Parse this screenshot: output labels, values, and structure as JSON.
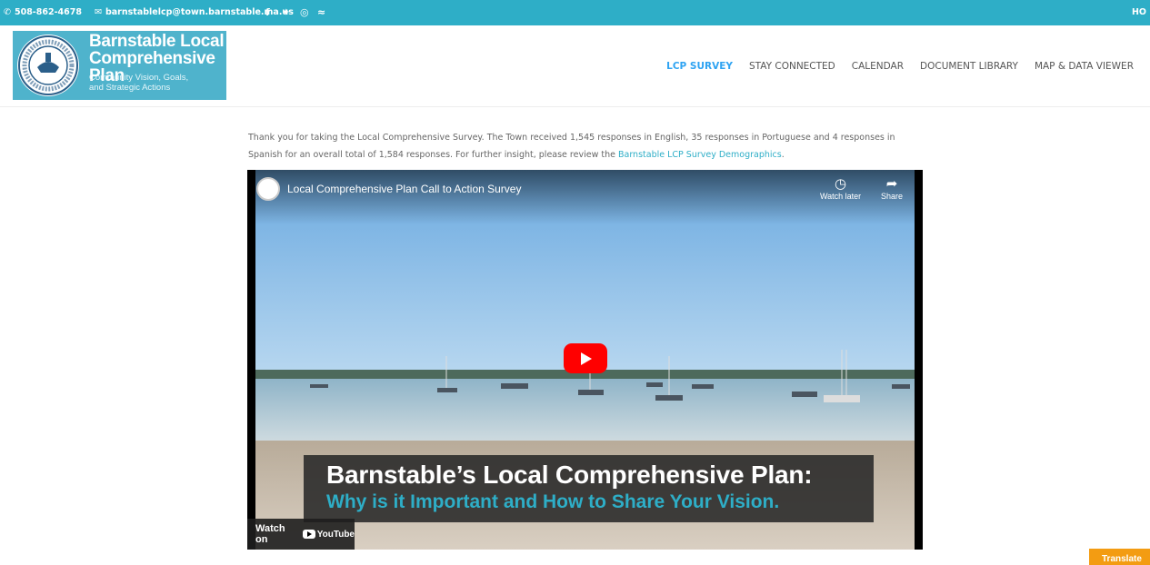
{
  "topbar": {
    "phone": "508-862-4678",
    "email": "barnstablelcp@town.barnstable.ma.us",
    "social_icons": [
      "facebook-icon",
      "twitter-icon",
      "instagram-icon",
      "rss-icon"
    ],
    "right_text": "HO"
  },
  "logo": {
    "title_line1": "Barnstable Local",
    "title_line2": "Comprehensive Plan",
    "sub_line1": "Community Vision, Goals,",
    "sub_line2": "and Strategic Actions"
  },
  "nav": {
    "items": [
      "LCP SURVEY",
      "STAY CONNECTED",
      "CALENDAR",
      "DOCUMENT LIBRARY",
      "MAP & DATA VIEWER"
    ],
    "active": "LCP SURVEY"
  },
  "intro": {
    "text": "Thank you for taking the Local Comprehensive Survey. The Town received 1,545 responses in English, 35 responses in Portuguese and 4 responses in Spanish for an overall total of 1,584 responses. For further insight, please review the ",
    "link": "Barnstable LCP Survey Demographics",
    "end": "."
  },
  "video": {
    "title": "Local Comprehensive Plan Call to Action Survey",
    "watch_later": "Watch later",
    "share": "Share",
    "banner_line1": "Barnstable’s Local Comprehensive Plan:",
    "banner_line2": "Why is it Important and How to Share Your Vision.",
    "watch_on": "Watch on",
    "youtube": "YouTube"
  },
  "translate": "Translate",
  "colors": {
    "accent": "#2eaec7",
    "nav_active": "#2ea3f2",
    "translate": "#f39c12"
  }
}
